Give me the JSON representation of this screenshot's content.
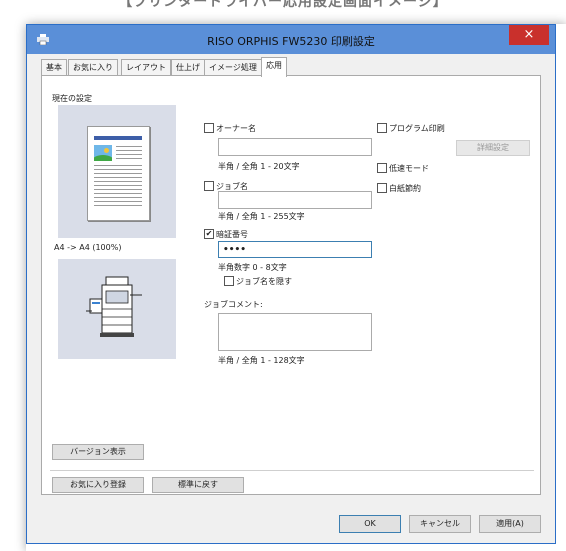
{
  "banner": "【プリンタードライバー応用設定画面イメージ】",
  "window": {
    "title": "RISO ORPHIS FW5230 印刷設定",
    "close_glyph": "×"
  },
  "tabs": [
    "基本",
    "お気に入り",
    "レイアウト",
    "仕上げ",
    "イメージ処理",
    "応用"
  ],
  "active_tab": "応用",
  "preview": {
    "label": "現在の設定",
    "paper_info": "A4 -> A4 (100%)"
  },
  "owner": {
    "label": "オーナー名",
    "checked": false,
    "value": "",
    "hint": "半角 / 全角 1 - 20文字"
  },
  "job": {
    "label": "ジョブ名",
    "checked": false,
    "value": "",
    "hint": "半角 / 全角 1 - 255文字"
  },
  "pin": {
    "label": "暗証番号",
    "checked": true,
    "value": "••••",
    "hint": "半角数字 0 - 8文字",
    "hide_job": {
      "label": "ジョブ名を隠す",
      "checked": false
    }
  },
  "comment": {
    "label": "ジョブコメント:",
    "value": "",
    "hint": "半角 / 全角 1 - 128文字"
  },
  "program": {
    "label": "プログラム印刷",
    "checked": false,
    "detail_button": "詳細設定"
  },
  "low_speed": {
    "label": "低速モード",
    "checked": false
  },
  "blank_save": {
    "label": "白紙節約",
    "checked": false
  },
  "version_button": "バージョン表示",
  "favorite_button": "お気に入り登録",
  "reset_button": "標準に戻す",
  "footer": {
    "ok": "OK",
    "cancel": "キャンセル",
    "apply": "適用(A)"
  },
  "colors": {
    "titlebar": "#5a8fd8",
    "close": "#c9302c",
    "preview_bg": "#d9dde8",
    "focus": "#3c7fb1"
  }
}
